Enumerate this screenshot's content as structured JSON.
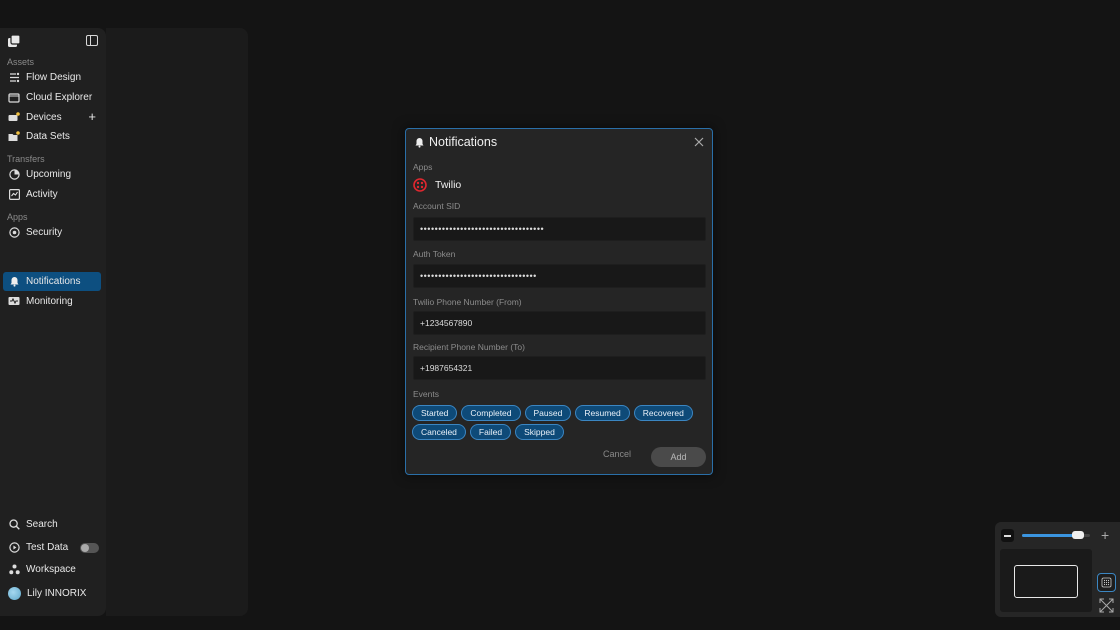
{
  "sidebar": {
    "sections": [
      {
        "label": "Assets"
      },
      {
        "label": "Transfers"
      },
      {
        "label": "Apps"
      }
    ],
    "items": [
      {
        "label": "Flow Design",
        "icon": "flow-icon"
      },
      {
        "label": "Cloud Explorer",
        "icon": "cloud-icon"
      },
      {
        "label": "Devices",
        "icon": "devices-icon"
      },
      {
        "label": "Data Sets",
        "icon": "folder-icon"
      },
      {
        "label": "Upcoming",
        "icon": "clock-icon"
      },
      {
        "label": "Activity",
        "icon": "activity-icon"
      },
      {
        "label": "Security",
        "icon": "shield-icon"
      },
      {
        "label": "Notifications",
        "icon": "bell-icon",
        "active": true
      },
      {
        "label": "Monitoring",
        "icon": "monitor-icon"
      }
    ],
    "bottom": [
      {
        "label": "Search",
        "icon": "search-icon"
      },
      {
        "label": "Test Data",
        "icon": "play-icon",
        "toggle": false
      },
      {
        "label": "Workspace",
        "icon": "workspace-icon"
      },
      {
        "label": "Lily INNORIX",
        "icon": "avatar"
      }
    ]
  },
  "modal": {
    "title": "Notifications",
    "apps_label": "Apps",
    "app_name": "Twilio",
    "account_sid_label": "Account SID",
    "account_sid_value": "••••••••••••••••••••••••••••••••••",
    "auth_token_label": "Auth Token",
    "auth_token_value": "••••••••••••••••••••••••••••••••",
    "from_label": "Twilio Phone Number (From)",
    "from_value": "+1234567890",
    "to_label": "Recipient Phone Number (To)",
    "to_value": "+1987654321",
    "events_label": "Events",
    "events_row1": [
      "Started",
      "Completed",
      "Paused",
      "Resumed",
      "Recovered"
    ],
    "events_row2": [
      "Canceled",
      "Failed",
      "Skipped"
    ],
    "cancel_label": "Cancel",
    "add_label": "Add"
  },
  "zoom": {
    "level": 0.9
  },
  "colors": {
    "accent": "#0d4f80",
    "twilio": "#e0272f"
  }
}
